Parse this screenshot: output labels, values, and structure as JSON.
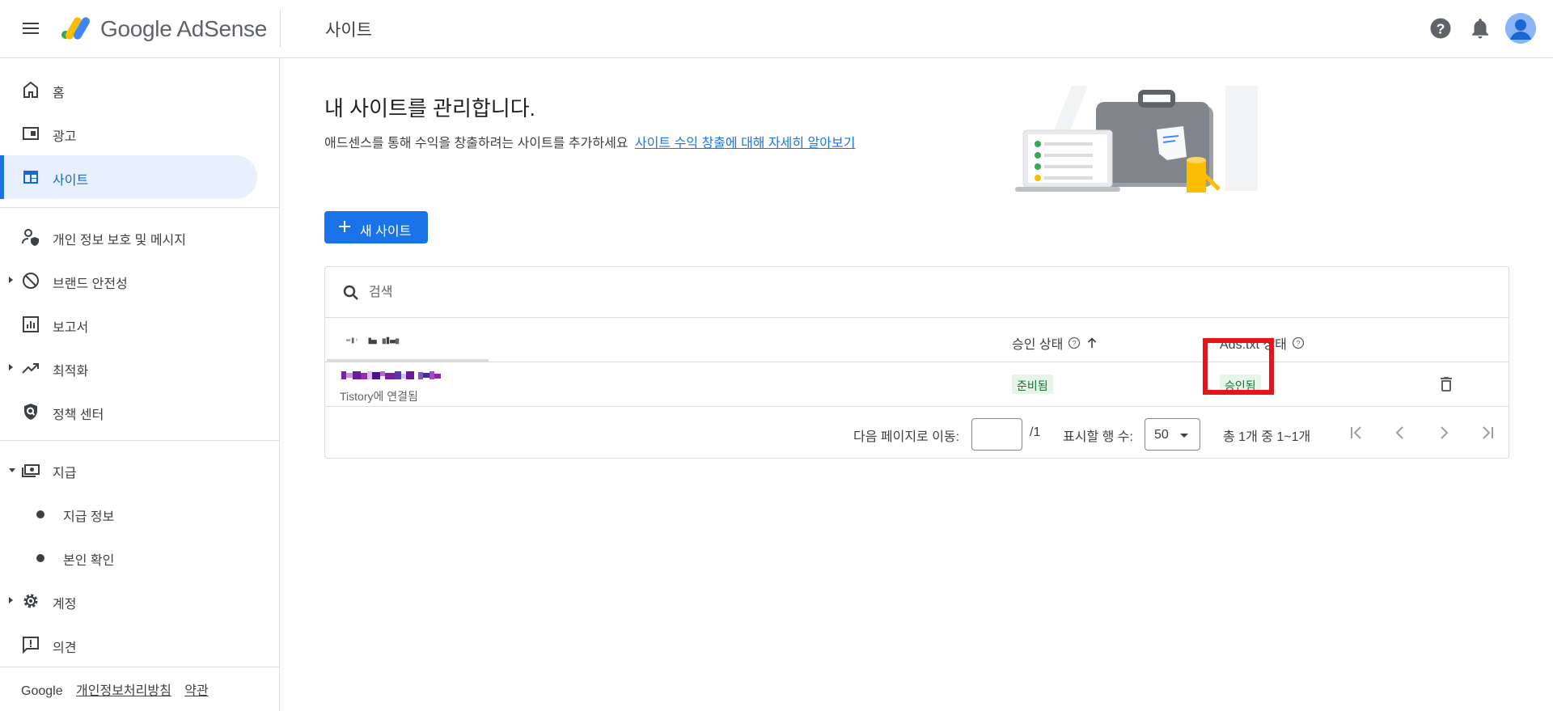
{
  "app": {
    "brand": "Google AdSense",
    "page_title": "사이트"
  },
  "sidebar": {
    "items": [
      {
        "label": "홈",
        "icon": "home-icon"
      },
      {
        "label": "광고",
        "icon": "ads-icon"
      },
      {
        "label": "사이트",
        "icon": "sites-icon",
        "active": true
      },
      {
        "label": "개인 정보 보호 및 메시지",
        "icon": "privacy-messaging-icon"
      },
      {
        "label": "브랜드 안전성",
        "icon": "block-icon"
      },
      {
        "label": "보고서",
        "icon": "reports-icon"
      },
      {
        "label": "최적화",
        "icon": "trending-up-icon"
      },
      {
        "label": "정책 센터",
        "icon": "policy-shield-icon"
      },
      {
        "label": "지급",
        "icon": "payments-icon"
      },
      {
        "label": "지급 정보",
        "icon": "dot-icon"
      },
      {
        "label": "본인 확인",
        "icon": "dot-icon"
      },
      {
        "label": "계정",
        "icon": "gear-icon"
      },
      {
        "label": "의견",
        "icon": "feedback-icon"
      }
    ],
    "footer": {
      "brand": "Google",
      "privacy": "개인정보처리방침",
      "terms": "약관"
    }
  },
  "main": {
    "heading": "내 사이트를 관리합니다.",
    "subtext": "애드센스를 통해 수익을 창출하려는 사이트를 추가하세요",
    "learn_more": "사이트 수익 창출에 대해 자세히 알아보기",
    "new_site_button": "새 사이트"
  },
  "table": {
    "search_placeholder": "검색",
    "columns": {
      "approval": "승인 상태",
      "ads_txt": "Ads.txt 상태"
    },
    "rows": [
      {
        "site_sub": "Tistory에 연결됨",
        "approval_status": "준비됨",
        "ads_txt_status": "승인됨"
      }
    ],
    "pager": {
      "goto_label": "다음 페이지로 이동:",
      "page_value": "",
      "page_total": "/1",
      "rows_label": "표시할 행 수:",
      "rows_value": "50",
      "range": "총 1개 중 1~1개"
    }
  },
  "colors": {
    "accent": "#1a73e8",
    "active_bg": "#e8f0fe",
    "badge_bg": "#e6f4ea",
    "badge_text": "#137333",
    "highlight_box": "#e8141a"
  }
}
